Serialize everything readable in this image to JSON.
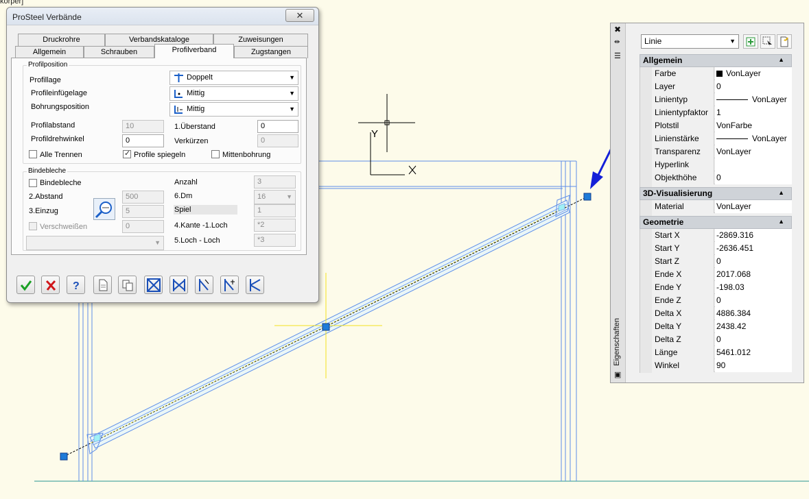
{
  "corner_label": "körper]",
  "drawing": {
    "ucs": {
      "y_label": "Y",
      "x_label": "X"
    }
  },
  "dialog": {
    "title": "ProSteel Verbände",
    "close_glyph": "✕",
    "tabs_row1": [
      "Druckrohre",
      "Verbandskataloge",
      "Zuweisungen"
    ],
    "tabs_row2": [
      "Allgemein",
      "Schrauben",
      "Profilverband",
      "Zugstangen"
    ],
    "active_tab": "Profilverband",
    "profilposition": {
      "legend": "Profilposition",
      "profillage_label": "Profillage",
      "profillage_value": "Doppelt",
      "einfuege_label": "Profileinfügelage",
      "einfuege_value": "Mittig",
      "bohrung_label": "Bohrungsposition",
      "bohrung_value": "Mittig",
      "profilabstand_label": "Profilabstand",
      "profilabstand_value": "10",
      "ueberstand_label": "1.Überstand",
      "ueberstand_value": "0",
      "drehwinkel_label": "Profildrehwinkel",
      "drehwinkel_value": "0",
      "verkuerzen_label": "Verkürzen",
      "verkuerzen_value": "0",
      "alle_trennen": "Alle Trennen",
      "profile_spiegeln": "Profile spiegeln",
      "mittenbohrung": "Mittenbohrung"
    },
    "bindebleche": {
      "legend": "Bindebleche",
      "bindebleche_cb": "Bindebleche",
      "abstand_label": "2.Abstand",
      "abstand_value": "500",
      "einzug_label": "3.Einzug",
      "einzug_value": "5",
      "verschweissen": "Verschweißen",
      "verschweissen_value": "0",
      "anzahl_label": "Anzahl",
      "anzahl_value": "3",
      "dm_label": "6.Dm",
      "dm_value": "16",
      "spiel_label": "Spiel",
      "spiel_value": "1",
      "kante_label": "4.Kante -1.Loch",
      "kante_value": "*2",
      "loch_label": "5.Loch - Loch",
      "loch_value": "*3"
    }
  },
  "palette": {
    "vertical_title": "Eigenschaften",
    "selection": "Linie",
    "sections": [
      {
        "title": "Allgemein",
        "rows": [
          {
            "name": "Farbe",
            "value": "VonLayer",
            "swatch": "#000000"
          },
          {
            "name": "Layer",
            "value": "0"
          },
          {
            "name": "Linientyp",
            "value": "VonLayer",
            "line": true
          },
          {
            "name": "Linientypfaktor",
            "value": "1"
          },
          {
            "name": "Plotstil",
            "value": "VonFarbe"
          },
          {
            "name": "Linienstärke",
            "value": "VonLayer",
            "line": true
          },
          {
            "name": "Transparenz",
            "value": "VonLayer"
          },
          {
            "name": "Hyperlink",
            "value": ""
          },
          {
            "name": "Objekthöhe",
            "value": "0"
          }
        ]
      },
      {
        "title": "3D-Visualisierung",
        "rows": [
          {
            "name": "Material",
            "value": "VonLayer"
          }
        ]
      },
      {
        "title": "Geometrie",
        "rows": [
          {
            "name": "Start X",
            "value": "-2869.316"
          },
          {
            "name": "Start Y",
            "value": "-2636.451"
          },
          {
            "name": "Start Z",
            "value": "0"
          },
          {
            "name": "Ende X",
            "value": "2017.068"
          },
          {
            "name": "Ende Y",
            "value": "-198.03"
          },
          {
            "name": "Ende Z",
            "value": "0"
          },
          {
            "name": "Delta X",
            "value": "4886.384"
          },
          {
            "name": "Delta Y",
            "value": "2438.42"
          },
          {
            "name": "Delta Z",
            "value": "0"
          },
          {
            "name": "Länge",
            "value": "5461.012"
          },
          {
            "name": "Winkel",
            "value": "90"
          }
        ]
      }
    ]
  },
  "colors": {
    "background": "#fdfbea",
    "frame_lines": "#5d8ee8",
    "grip": "#1e7bd8",
    "crosshair": "#f2e21e",
    "arrow": "#1420d8",
    "ground": "#6fb7b0"
  }
}
